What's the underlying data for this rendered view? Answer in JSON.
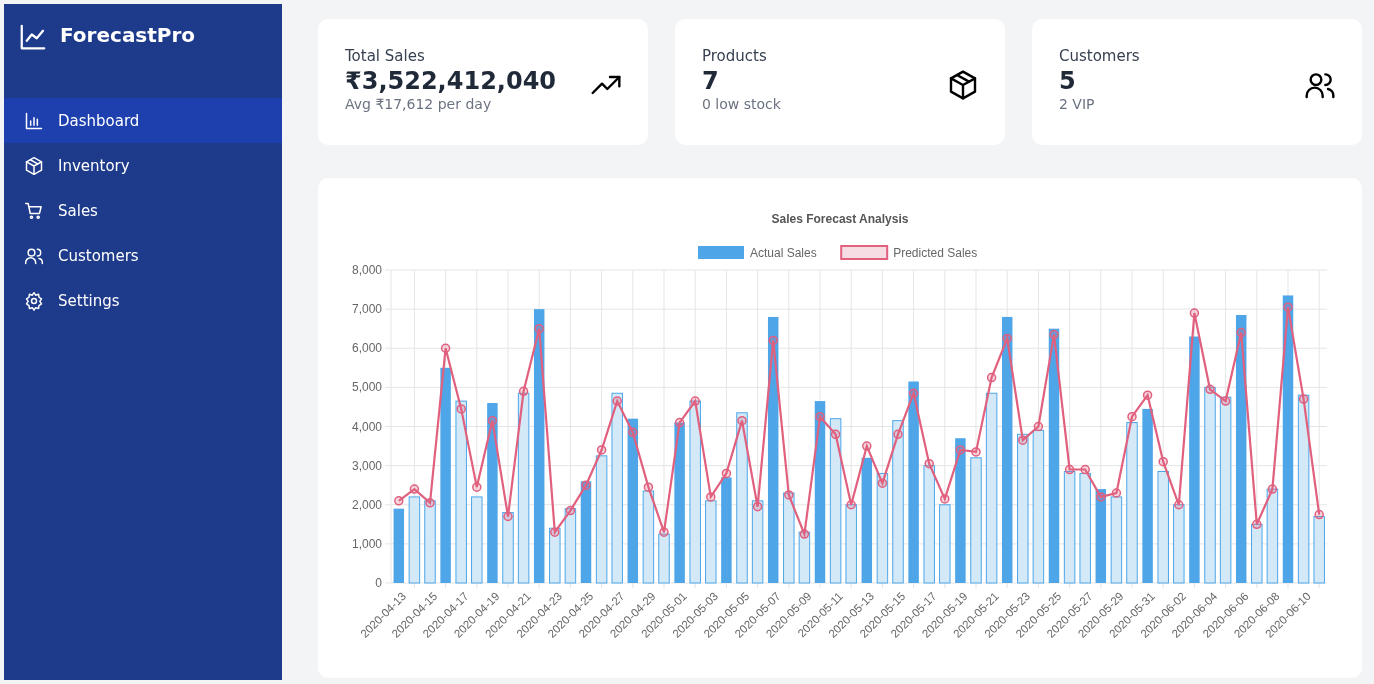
{
  "sidebar": {
    "brand": "ForecastPro",
    "items": [
      {
        "label": "Dashboard",
        "selected": true
      },
      {
        "label": "Inventory",
        "selected": false
      },
      {
        "label": "Sales",
        "selected": false
      },
      {
        "label": "Customers",
        "selected": false
      },
      {
        "label": "Settings",
        "selected": false
      }
    ]
  },
  "stats": [
    {
      "label": "Total Sales",
      "value": "₹3,522,412,040",
      "note": "Avg ₹17,612 per day"
    },
    {
      "label": "Products",
      "value": "7",
      "note": "0 low stock"
    },
    {
      "label": "Customers",
      "value": "5",
      "note": "2 VIP"
    }
  ],
  "chart": {
    "chart_data": {
      "type": "bar",
      "title": "Sales Forecast Analysis",
      "grid": true,
      "legend": true,
      "categories": [
        "2020-04-13",
        null,
        "2020-04-15",
        null,
        "2020-04-17",
        null,
        "2020-04-19",
        null,
        "2020-04-21",
        null,
        "2020-04-23",
        null,
        "2020-04-25",
        null,
        "2020-04-27",
        null,
        "2020-04-29",
        null,
        "2020-05-01",
        null,
        "2020-05-03",
        null,
        "2020-05-05",
        null,
        "2020-05-07",
        null,
        "2020-05-09",
        null,
        "2020-05-11",
        null,
        "2020-05-13",
        null,
        "2020-05-15",
        null,
        "2020-05-17",
        null,
        "2020-05-19",
        null,
        "2020-05-21",
        null,
        "2020-05-23",
        null,
        "2020-05-25",
        null,
        "2020-05-27",
        null,
        "2020-05-29",
        null,
        "2020-05-31",
        null,
        "2020-06-02",
        null,
        "2020-06-04",
        null,
        "2020-06-06",
        null,
        "2020-06-08",
        null,
        "2020-06-10",
        null
      ],
      "ylim": [
        0,
        8000
      ],
      "yticks": [
        {
          "value": 0,
          "label": "0"
        },
        {
          "value": 1000,
          "label": "1,000"
        },
        {
          "value": 2000,
          "label": "2,000"
        },
        {
          "value": 3000,
          "label": "3,000"
        },
        {
          "value": 4000,
          "label": "4,000"
        },
        {
          "value": 5000,
          "label": "5,000"
        },
        {
          "value": 6000,
          "label": "6,000"
        },
        {
          "value": 7000,
          "label": "7,000"
        },
        {
          "value": 8000,
          "label": "8,000"
        }
      ],
      "series": [
        {
          "name": "Actual Sales",
          "type": "bar",
          "color": "#4ea6e8",
          "colors": [
            "#4ea6e8",
            "#d3e9f8",
            "#d3e9f8",
            "#4ea6e8",
            "#d3e9f8",
            "#d3e9f8",
            "#4ea6e8",
            "#d3e9f8",
            "#d3e9f8",
            "#4ea6e8",
            "#d3e9f8",
            "#d3e9f8",
            "#4ea6e8",
            "#d3e9f8",
            "#d3e9f8",
            "#4ea6e8",
            "#d3e9f8",
            "#d3e9f8",
            "#4ea6e8",
            "#d3e9f8",
            "#d3e9f8",
            "#4ea6e8",
            "#d3e9f8",
            "#d3e9f8",
            "#4ea6e8",
            "#d3e9f8",
            "#d3e9f8",
            "#4ea6e8",
            "#d3e9f8",
            "#d3e9f8",
            "#4ea6e8",
            "#d3e9f8",
            "#d3e9f8",
            "#4ea6e8",
            "#d3e9f8",
            "#d3e9f8",
            "#4ea6e8",
            "#d3e9f8",
            "#d3e9f8",
            "#4ea6e8",
            "#d3e9f8",
            "#d3e9f8",
            "#4ea6e8",
            "#d3e9f8",
            "#d3e9f8",
            "#4ea6e8",
            "#d3e9f8",
            "#d3e9f8",
            "#4ea6e8",
            "#d3e9f8",
            "#d3e9f8",
            "#4ea6e8",
            "#d3e9f8",
            "#d3e9f8",
            "#4ea6e8",
            "#d3e9f8",
            "#d3e9f8",
            "#4ea6e8",
            "#d3e9f8",
            "#d3e9f8"
          ],
          "values": [
            1900,
            2200,
            2100,
            5500,
            4650,
            2200,
            4600,
            1800,
            4850,
            7000,
            1400,
            1900,
            2600,
            3250,
            4850,
            4200,
            2350,
            1250,
            4100,
            4650,
            2100,
            2700,
            4350,
            2100,
            6800,
            2300,
            1300,
            4650,
            4200,
            2000,
            3200,
            2800,
            4150,
            5150,
            3000,
            2000,
            3700,
            3200,
            4850,
            6800,
            3800,
            3900,
            6500,
            2850,
            2800,
            2400,
            2200,
            4100,
            4450,
            2850,
            2000,
            6300,
            5000,
            4750,
            6850,
            1500,
            2400,
            7350,
            4800,
            1700
          ]
        },
        {
          "name": "Predicted Sales",
          "type": "line",
          "color": "#e0607e",
          "marker": "circle",
          "values": [
            2100,
            2400,
            2050,
            6000,
            4450,
            2450,
            4150,
            1700,
            4900,
            6500,
            1300,
            1850,
            2500,
            3400,
            4650,
            3850,
            2450,
            1300,
            4100,
            4650,
            2200,
            2800,
            4150,
            1950,
            6200,
            2250,
            1250,
            4250,
            3800,
            2000,
            3500,
            2550,
            3800,
            4850,
            3050,
            2150,
            3400,
            3350,
            5250,
            6250,
            3650,
            4000,
            6350,
            2900,
            2900,
            2200,
            2300,
            4250,
            4800,
            3100,
            2000,
            6900,
            4950,
            4650,
            6400,
            1500,
            2400,
            7050,
            4700,
            1750
          ]
        }
      ]
    }
  }
}
